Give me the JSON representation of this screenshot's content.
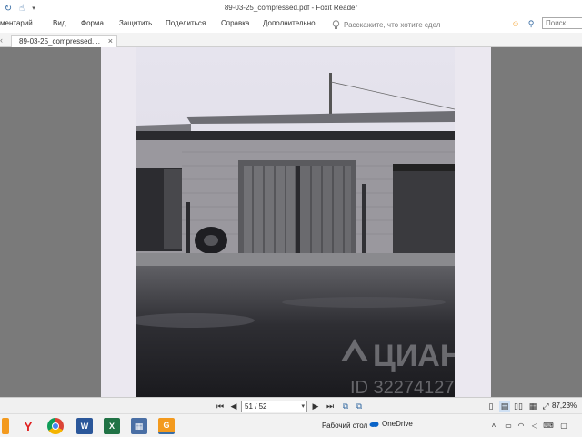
{
  "window": {
    "title": "89-03-25_compressed.pdf - Foxit Reader"
  },
  "quick_access": {
    "icons": [
      "refresh-icon",
      "cursor-hand-icon",
      "dropdown-icon"
    ]
  },
  "menu": {
    "items": [
      "ментарий",
      "Вид",
      "Форма",
      "Защитить",
      "Поделиться",
      "Справка",
      "Дополнительно"
    ],
    "tell_me_placeholder": "Расскажите, что хотите сдел",
    "search_placeholder": "Поиск"
  },
  "tabs": [
    {
      "label": "89-03-25_compressed...."
    }
  ],
  "document": {
    "watermark_text": "ЦИАН",
    "watermark_id": "ID 32274127"
  },
  "navigation": {
    "page_value": "51 / 52",
    "zoom": "87,23%"
  },
  "taskbar": {
    "desktop_label": "Рабочий стол",
    "onedrive_label": "OneDrive",
    "apps": [
      "yandex-browser-icon",
      "chrome-icon",
      "word-icon",
      "excel-icon",
      "calculator-icon",
      "foxit-reader-icon"
    ]
  },
  "colors": {
    "accent": "#3a6ea5",
    "foxit_orange": "#f39a1e",
    "word_blue": "#2b579a",
    "excel_green": "#217346"
  }
}
